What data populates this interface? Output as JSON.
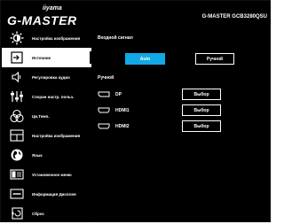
{
  "header": {
    "brand": "G-MASTER",
    "brand_sub": "iiyama",
    "model": "G-MASTER GCB3280QSU"
  },
  "sidebar": {
    "items": [
      {
        "label": "Настройка изображения",
        "icon": "picture-settings-icon"
      },
      {
        "label": "Источник",
        "icon": "input-source-icon"
      },
      {
        "label": "Регулировка аудио",
        "icon": "speaker-icon"
      },
      {
        "label": "Сохран настр. польз.",
        "icon": "user-settings-sliders-icon"
      },
      {
        "label": "Цв.Темп.",
        "icon": "color-temp-icon"
      },
      {
        "label": "Настройка изображения",
        "icon": "image-layout-icon"
      },
      {
        "label": "Язык",
        "icon": "globe-icon"
      },
      {
        "label": "Установочное меню",
        "icon": "setup-menu-icon"
      },
      {
        "label": "Информация Дисплея",
        "icon": "display-info-icon"
      },
      {
        "label": "Сброс",
        "icon": "reset-icon"
      }
    ],
    "active_index": 1
  },
  "content": {
    "input_signal_title": "Входной сигнал",
    "auto_label": "Auto",
    "manual_button_label": "Ручной",
    "manual_section_title": "Ручной",
    "ports": [
      {
        "label": "DP",
        "button": "Выбор"
      },
      {
        "label": "HDMI1",
        "button": "Выбор"
      },
      {
        "label": "HDMI2",
        "button": "Выбор"
      }
    ]
  },
  "colors": {
    "background": "#000000",
    "accent": "#12a9e6",
    "active_item_bg": "#ffffff"
  }
}
